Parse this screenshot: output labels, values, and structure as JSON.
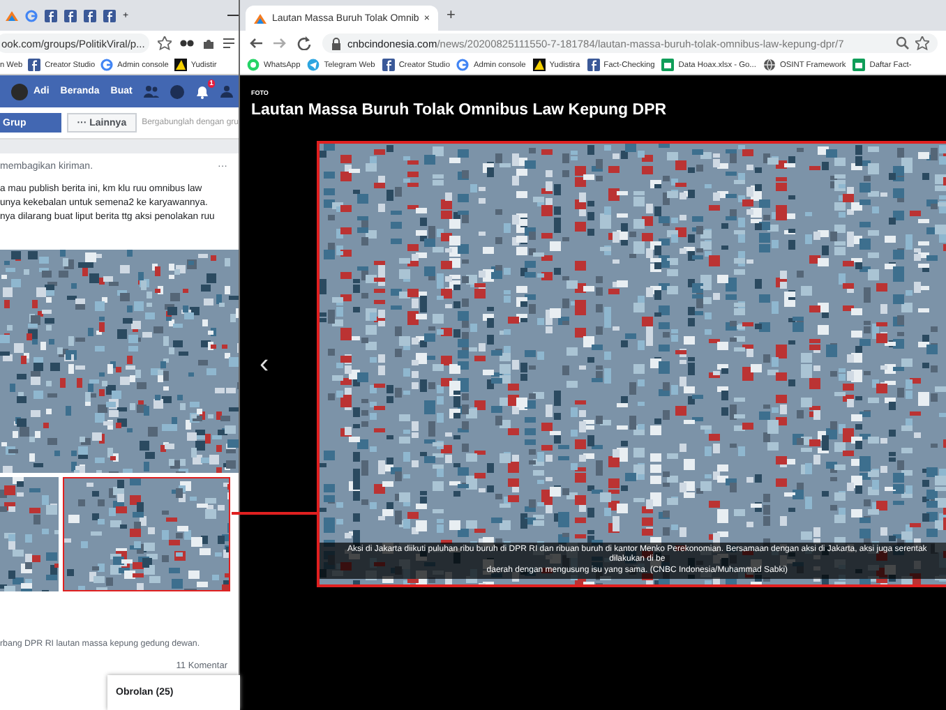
{
  "left_window": {
    "new_tab": "+",
    "address": "ook.com/groups/PolitikViral/p...",
    "bookmarks": [
      "n Web",
      "Creator Studio",
      "Admin console",
      "Yudistir"
    ],
    "nav": {
      "user": "Adi",
      "links": [
        "Beranda",
        "Buat"
      ],
      "notification_badge": "1"
    },
    "group_bar": {
      "group_button": "Grup",
      "more_button": "··· Lainnya",
      "join_text": "Bergabunglah dengan gru"
    },
    "post": {
      "shared_text": "membagikan kiriman.",
      "menu": "···",
      "body_lines": [
        "a mau publish berita ini, km klu ruu omnibus law",
        "unya kekebalan untuk semena2 ke karyawannya.",
        "nya dilarang buat liput berita ttg aksi penolakan ruu"
      ],
      "caption": "rbang DPR RI lautan massa kepung gedung dewan.",
      "comments": "11 Komentar"
    },
    "chat": {
      "label": "Obrolan (25)"
    }
  },
  "right_window": {
    "tab": {
      "title": "Lautan Massa Buruh Tolak Omnib",
      "close": "×"
    },
    "new_tab": "+",
    "address_host": "cnbcindonesia.com",
    "address_path": "/news/20200825111550-7-181784/lautan-massa-buruh-tolak-omnibus-law-kepung-dpr/7",
    "bookmarks": [
      "WhatsApp",
      "Telegram Web",
      "Creator Studio",
      "Admin console",
      "Yudistira",
      "Fact-Checking",
      "Data Hoax.xlsx - Go...",
      "OSINT Framework",
      "Daftar Fact-"
    ],
    "page": {
      "section": "FOTO",
      "title": "Lautan Massa Buruh Tolak Omnibus Law Kepung DPR",
      "prev": "‹",
      "caption_lines": [
        "Aksi di Jakarta diikuti puluhan ribu buruh di DPR RI dan ribuan buruh di kantor Menko Perekonomian. Bersamaan dengan aksi di Jakarta, aksi juga serentak dilakukan di be",
        "daerah dengan mengusung isu yang sama. (CNBC Indonesia/Muhammad Sabki)"
      ]
    }
  }
}
